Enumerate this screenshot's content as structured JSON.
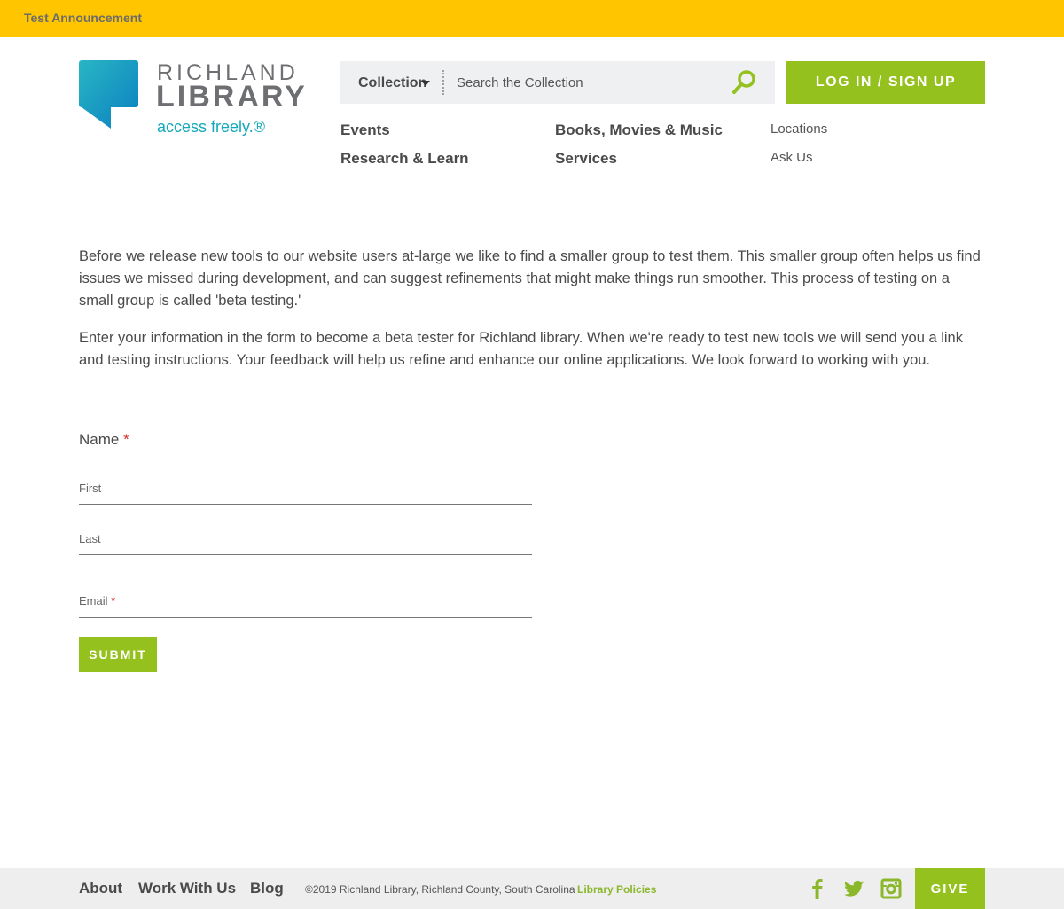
{
  "announcement": {
    "text": "Test Announcement"
  },
  "logo": {
    "line1": "RICHLAND",
    "line2": "LIBRARY",
    "tagline": "access freely.®"
  },
  "search": {
    "scope": "Collection",
    "placeholder": "Search the Collection"
  },
  "login": {
    "label": "LOG IN / SIGN UP"
  },
  "nav": {
    "primary": [
      "Events",
      "Research & Learn",
      "Books, Movies & Music",
      "Services"
    ],
    "secondary": [
      "Locations",
      "Ask Us"
    ]
  },
  "intro": {
    "p1": "Before we release new tools to our website users at-large we like to find a smaller group to test them. This smaller group often helps us find issues we missed during development, and can suggest refinements that might make things run smoother. This process of testing on a small group is called 'beta testing.'",
    "p2": "Enter your information in the form to become a beta tester for Richland library. When we're ready to test new tools we will send you a link and testing instructions. Your feedback will help us refine and enhance our online applications. We look forward to working with you."
  },
  "form": {
    "name_label": "Name",
    "first_label": "First",
    "last_label": "Last",
    "email_label": "Email",
    "required_mark": "*",
    "submit_label": "SUBMIT"
  },
  "footer": {
    "links": [
      "About",
      "Work With Us",
      "Blog"
    ],
    "copyright": "©2019 Richland Library, Richland County, South Carolina",
    "policies": "Library Policies",
    "social": [
      "facebook-icon",
      "twitter-icon",
      "instagram-icon"
    ],
    "give_label": "GIVE"
  },
  "colors": {
    "accent_yellow": "#ffc600",
    "accent_green": "#95c11f",
    "brand_teal": "#14a9b8"
  }
}
